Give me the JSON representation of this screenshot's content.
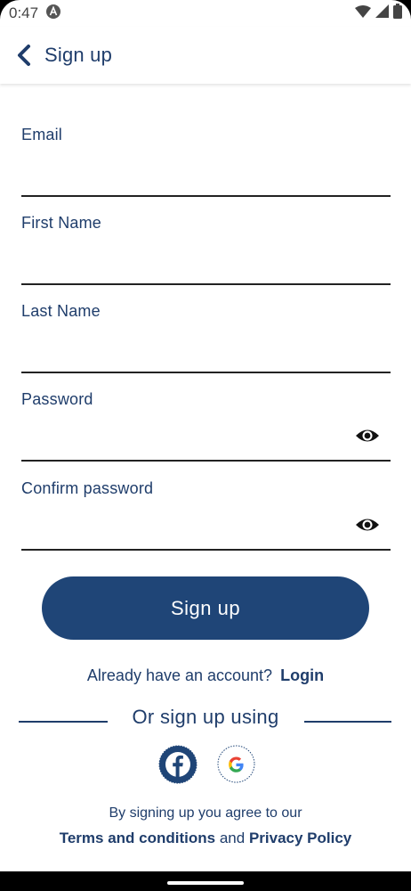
{
  "status_bar": {
    "time": "0:47"
  },
  "header": {
    "title": "Sign up"
  },
  "form": {
    "email_label": "Email",
    "first_name_label": "First Name",
    "last_name_label": "Last Name",
    "password_label": "Password",
    "confirm_password_label": "Confirm password"
  },
  "signup_button_label": "Sign up",
  "account": {
    "prompt": "Already have an account?",
    "login_label": "Login"
  },
  "divider_text": "Or sign up using",
  "terms": {
    "line1": "By signing up you agree to our",
    "terms_label": "Terms and conditions",
    "and": "and",
    "privacy_label": "Privacy Policy"
  },
  "colors": {
    "primary": "#1f4577",
    "text": "#1f3d6b",
    "field_border": "#222222"
  },
  "icons": [
    "android-icon",
    "wifi-icon",
    "signal-icon",
    "battery-icon",
    "back-arrow-icon",
    "eye-icon",
    "facebook-icon",
    "google-icon"
  ]
}
